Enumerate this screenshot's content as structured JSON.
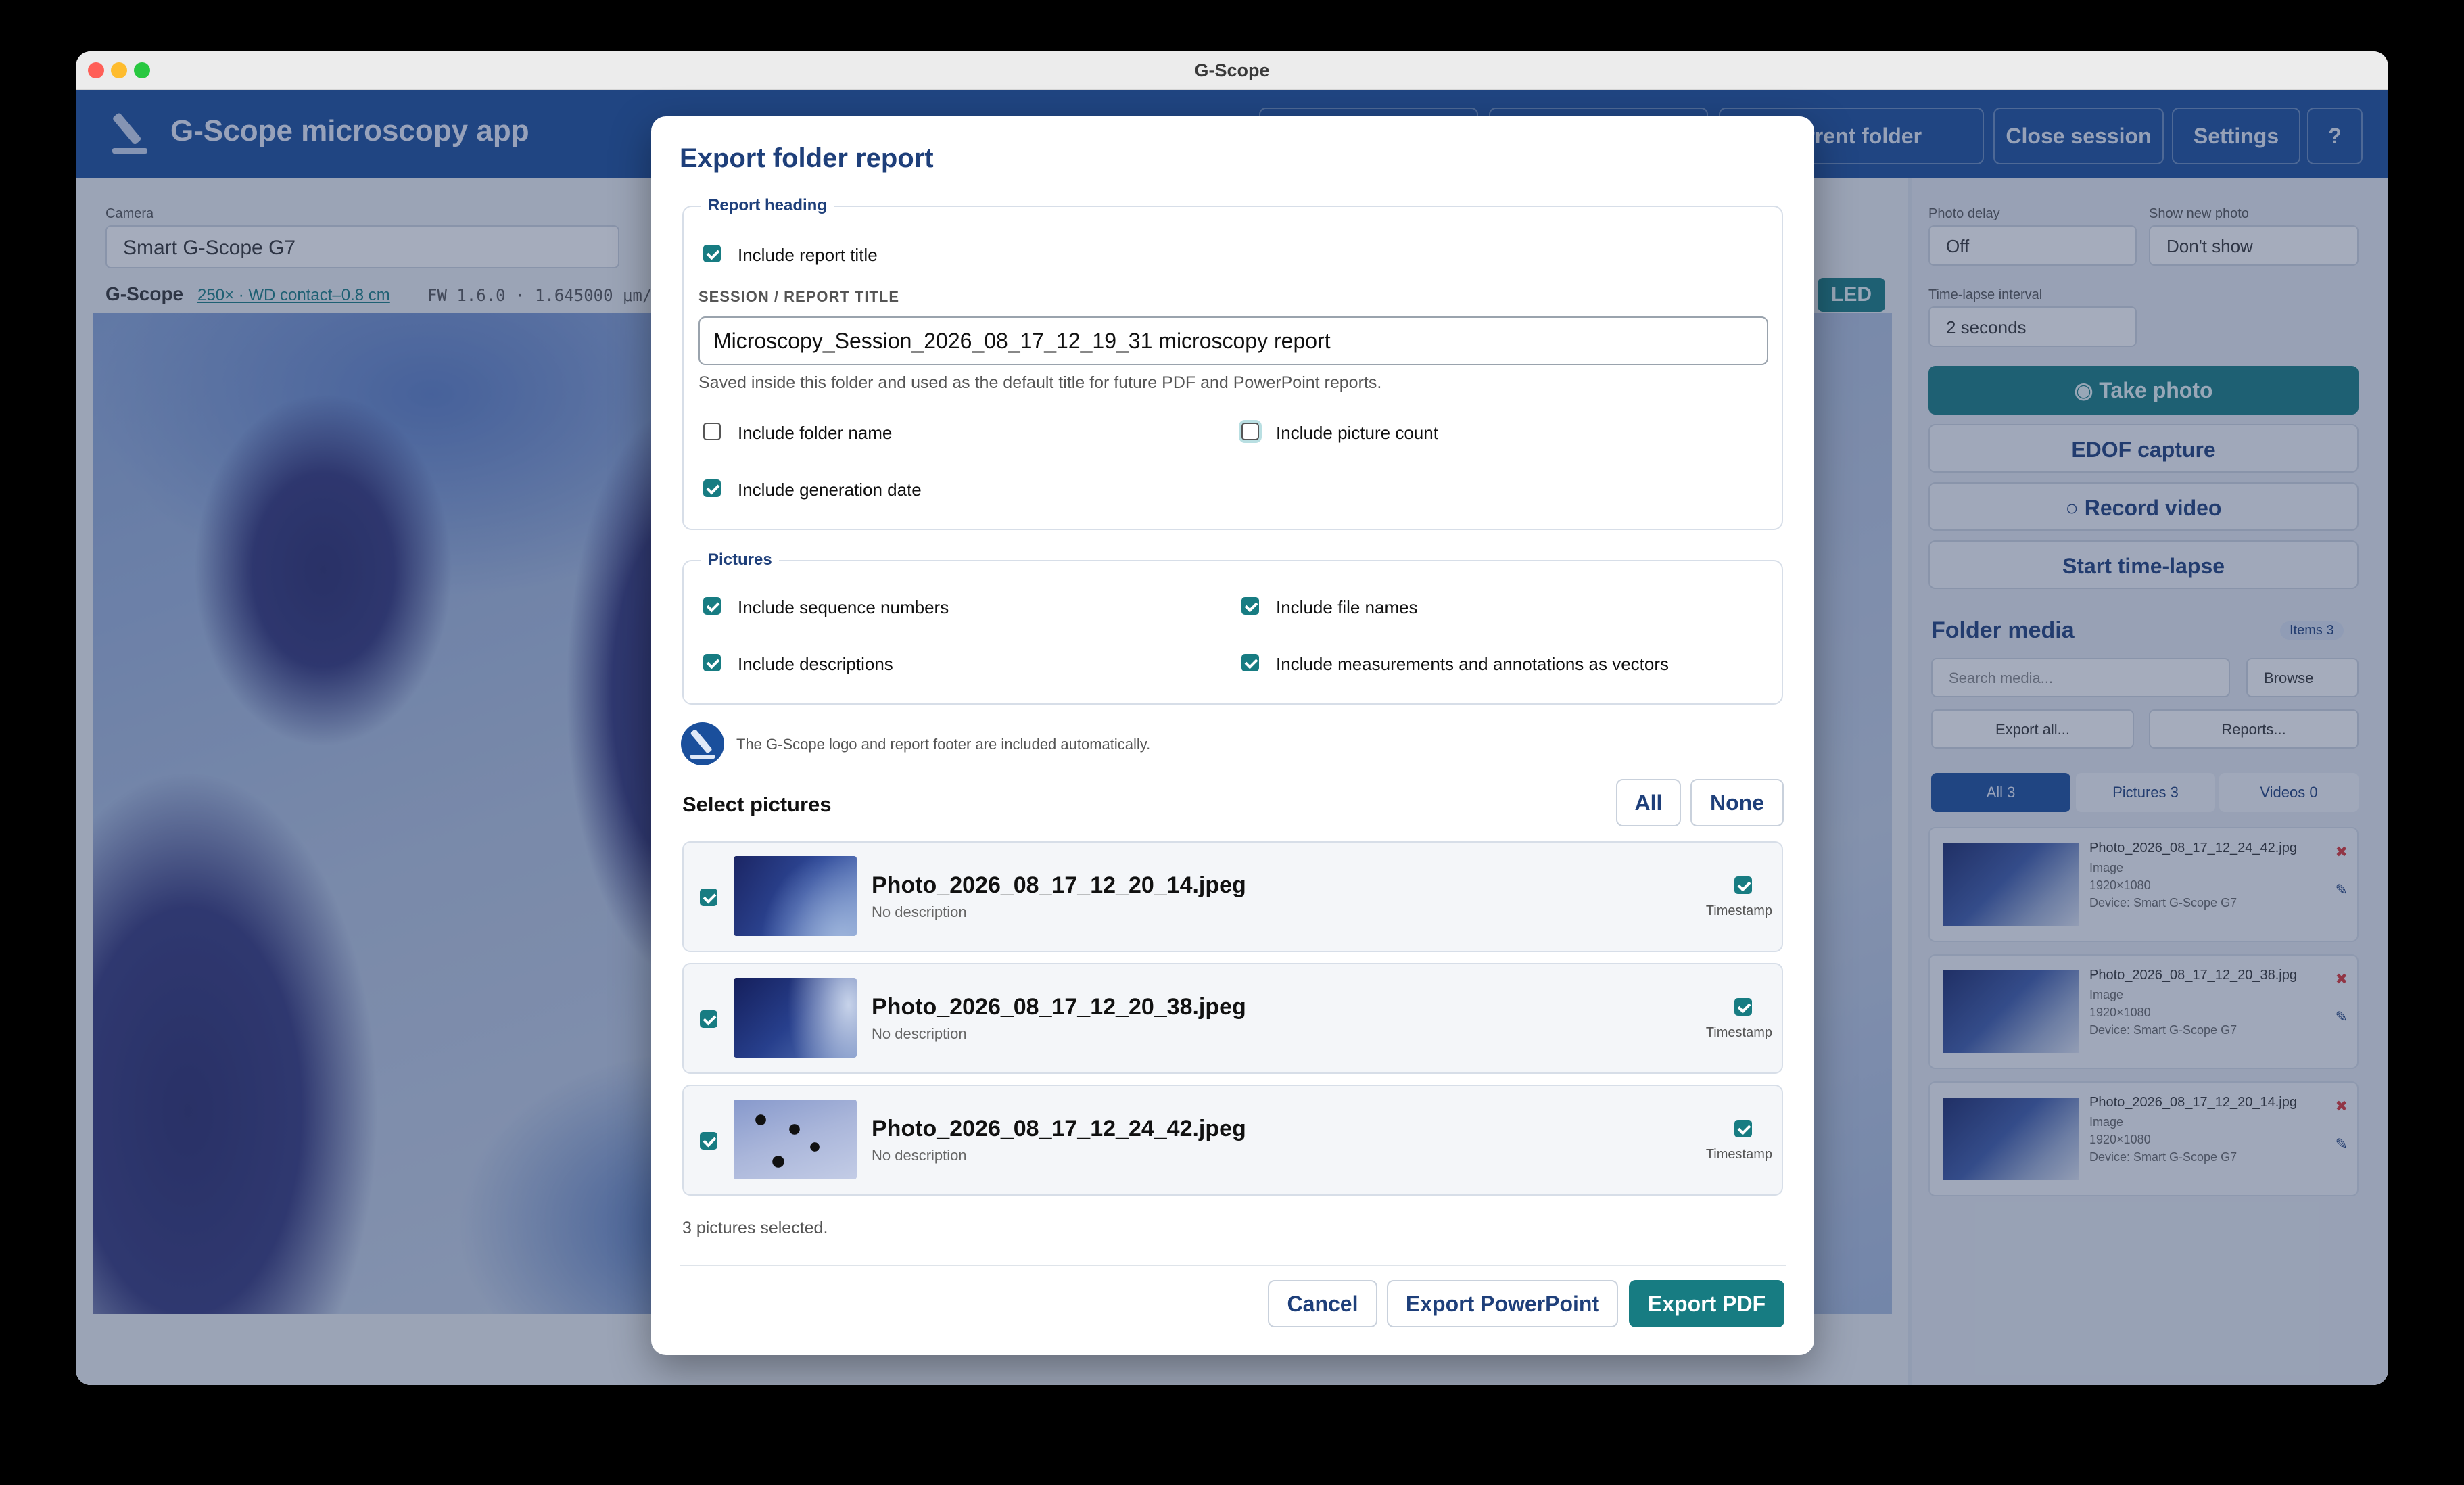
{
  "window": {
    "title": "G-Scope"
  },
  "app": {
    "title": "G-Scope microscopy app",
    "header_buttons": [
      "current folder",
      "Close session",
      "Settings",
      "?"
    ]
  },
  "left": {
    "camera_label": "Camera",
    "camera_value": "Smart G-Scope G7",
    "info_brand": "G-Scope",
    "info_magnification": "250× · WD contact–0.8 cm",
    "info_fw": "FW 1.6.0 · 1.645000 μm/px",
    "led_label": "LED"
  },
  "right": {
    "photo_delay_label": "Photo delay",
    "photo_delay_value": "Off",
    "show_new_photo_label": "Show new photo",
    "show_new_photo_value": "Don't show",
    "timelapse_label": "Time-lapse interval",
    "timelapse_value": "2 seconds",
    "take_photo": "Take photo",
    "edof_capture": "EDOF capture",
    "record_video": "Record video",
    "start_timelapse": "Start time-lapse",
    "folder_media": "Folder media",
    "items_badge": "Items 3",
    "search_placeholder": "Search media...",
    "browse": "Browse",
    "export_all": "Export all...",
    "reports": "Reports...",
    "filter_tabs": [
      "All 3",
      "Pictures 3",
      "Videos 0"
    ],
    "media": [
      {
        "name": "Photo_2026_08_17_12_24_42.jpg",
        "type": "Image",
        "res": "1920×1080",
        "device": "Device: Smart G-Scope G7"
      },
      {
        "name": "Photo_2026_08_17_12_20_38.jpg",
        "type": "Image",
        "res": "1920×1080",
        "device": "Device: Smart G-Scope G7"
      },
      {
        "name": "Photo_2026_08_17_12_20_14.jpg",
        "type": "Image",
        "res": "1920×1080",
        "device": "Device: Smart G-Scope G7"
      }
    ]
  },
  "modal": {
    "title": "Export folder report",
    "heading_section": "Report heading",
    "include_report_title": "Include report title",
    "session_title_label": "SESSION / REPORT TITLE",
    "session_title_value": "Microscopy_Session_2026_08_17_12_19_31 microscopy report",
    "session_help": "Saved inside this folder and used as the default title for future PDF and PowerPoint reports.",
    "include_folder_name": "Include folder name",
    "include_picture_count": "Include picture count",
    "include_generation_date": "Include generation date",
    "pictures_section": "Pictures",
    "include_sequence_numbers": "Include sequence numbers",
    "include_file_names": "Include file names",
    "include_descriptions": "Include descriptions",
    "include_measurements": "Include measurements and annotations as vectors",
    "logo_note": "The G-Scope logo and report footer are included automatically.",
    "select_pictures": "Select pictures",
    "all_button": "All",
    "none_button": "None",
    "pictures": [
      {
        "name": "Photo_2026_08_17_12_20_14.jpeg",
        "description": "No description",
        "timestamp_label": "Timestamp"
      },
      {
        "name": "Photo_2026_08_17_12_20_38.jpeg",
        "description": "No description",
        "timestamp_label": "Timestamp"
      },
      {
        "name": "Photo_2026_08_17_12_24_42.jpeg",
        "description": "No description",
        "timestamp_label": "Timestamp"
      }
    ],
    "selected_count": "3 pictures selected.",
    "cancel": "Cancel",
    "export_powerpoint": "Export PowerPoint",
    "export_pdf": "Export PDF"
  },
  "colors": {
    "accent": "#177c82",
    "brand": "#1a4f9c",
    "title": "#1e3f7a"
  },
  "icons": [
    "close-dot-icon",
    "minimize-dot-icon",
    "zoom-dot-icon",
    "microscope-logo-icon",
    "camera-icon",
    "record-icon",
    "chevron-down-icon",
    "folder-icon",
    "delete-icon",
    "edit-icon",
    "check-icon"
  ]
}
